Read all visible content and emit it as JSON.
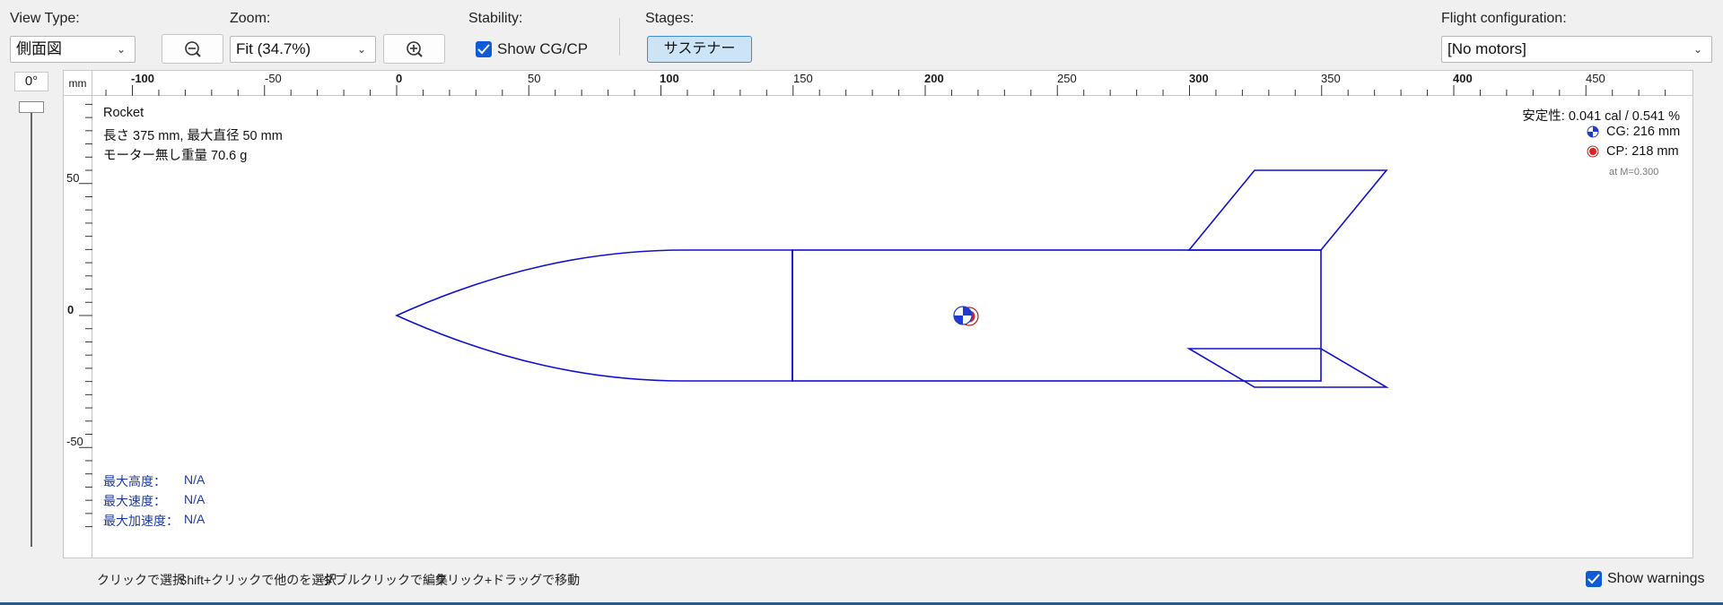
{
  "toolbar": {
    "view_type_label": "View Type:",
    "view_type_value": "側面図",
    "zoom_label": "Zoom:",
    "zoom_value": "Fit (34.7%)",
    "stability_label": "Stability:",
    "show_cgcp_label": "Show CG/CP",
    "show_cgcp_checked": true,
    "stages_label": "Stages:",
    "stage_button": "サステナー",
    "flight_config_label": "Flight configuration:",
    "flight_config_value": "[No motors]"
  },
  "rotation": {
    "angle": "0°"
  },
  "ruler": {
    "unit": "mm",
    "h_ticks": [
      "-100",
      "-50",
      "0",
      "50",
      "100",
      "150",
      "200",
      "250",
      "300",
      "350",
      "400",
      "450"
    ],
    "v_ticks": [
      "50",
      "0",
      "-50"
    ]
  },
  "rocket_info": {
    "name": "Rocket",
    "dimensions": "長さ 375 mm, 最大直径 50 mm",
    "mass": "モーター無し重量 70.6 g"
  },
  "stability_info": {
    "stability": "安定性: 0.041 cal / 0.541 %",
    "cg": "CG: 216 mm",
    "cp": "CP: 218 mm",
    "mach": "at M=0.300",
    "cg_color": "#1f3ad0",
    "cp_color": "#e02020"
  },
  "flight_info": {
    "max_altitude_label": "最大高度：",
    "max_altitude_value": "N/A",
    "max_velocity_label": "最大速度：",
    "max_velocity_value": "N/A",
    "max_accel_label": "最大加速度：",
    "max_accel_value": "N/A"
  },
  "status_bar": {
    "hints": [
      "クリックで選択",
      "Shift+クリックで他のを選択",
      "ダブルクリックで編集",
      "クリック+ドラッグで移動"
    ],
    "show_warnings_label": "Show warnings",
    "show_warnings_checked": true
  },
  "colors": {
    "rocket_outline": "#1010cc",
    "accent": "#0f5bd6"
  }
}
